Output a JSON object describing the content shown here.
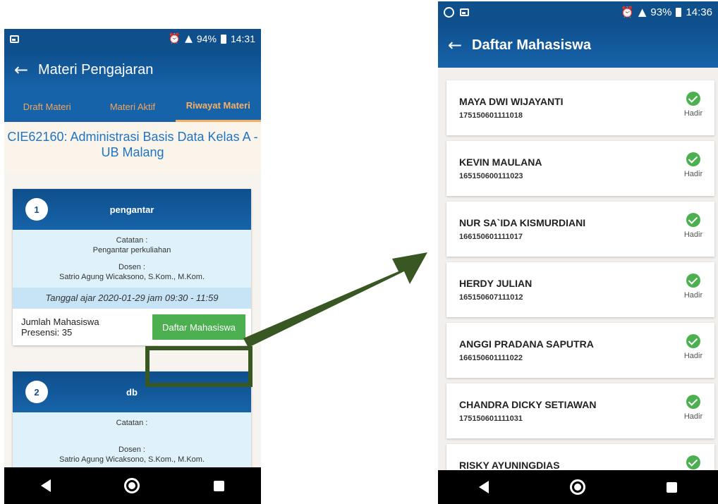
{
  "left_screen": {
    "status": {
      "battery": "94%",
      "time": "14:31"
    },
    "app_title": "Materi Pengajaran",
    "tabs": [
      {
        "label": "Draft Materi"
      },
      {
        "label": "Materi Aktif"
      },
      {
        "label": "Riwayat Materi"
      }
    ],
    "course_title": "CIE62160: Administrasi Basis Data Kelas A - UB Malang",
    "materi": [
      {
        "number": "1",
        "title": "pengantar",
        "catatan_label": "Catatan :",
        "catatan": "Pengantar perkuliahan",
        "dosen_label": "Dosen :",
        "dosen": "Satrio Agung Wicaksono, S.Kom., M.Kom.",
        "tanggal": "Tanggal ajar 2020-01-29 jam 09:30 - 11:59",
        "jumlah_line1": "Jumlah Mahasiswa",
        "jumlah_line2": "Presensi: 35",
        "button": "Daftar Mahasiswa"
      },
      {
        "number": "2",
        "title": "db",
        "catatan_label": "Catatan :",
        "catatan": "",
        "dosen_label": "Dosen :",
        "dosen": "Satrio Agung Wicaksono, S.Kom., M.Kom."
      }
    ]
  },
  "right_screen": {
    "status": {
      "battery": "93%",
      "time": "14:36"
    },
    "app_title": "Daftar Mahasiswa",
    "students": [
      {
        "name": "MAYA DWI WIJAYANTI",
        "nim": "175150601111018",
        "status": "Hadir"
      },
      {
        "name": "KEVIN MAULANA",
        "nim": "165150600111023",
        "status": "Hadir"
      },
      {
        "name": "NUR SA`IDA KISMURDIANI",
        "nim": "166150601111017",
        "status": "Hadir"
      },
      {
        "name": "HERDY JULIAN",
        "nim": "165150607111012",
        "status": "Hadir"
      },
      {
        "name": "ANGGI PRADANA SAPUTRA",
        "nim": "166150601111022",
        "status": "Hadir"
      },
      {
        "name": "CHANDRA DICKY SETIAWAN",
        "nim": "175150601111031",
        "status": "Hadir"
      },
      {
        "name": "RISKY AYUNINGDIAS",
        "nim": "",
        "status": ""
      }
    ]
  },
  "colors": {
    "primary": "#0e4f8c",
    "accent": "#f7b061",
    "success": "#4caf50",
    "arrow": "#385723"
  }
}
